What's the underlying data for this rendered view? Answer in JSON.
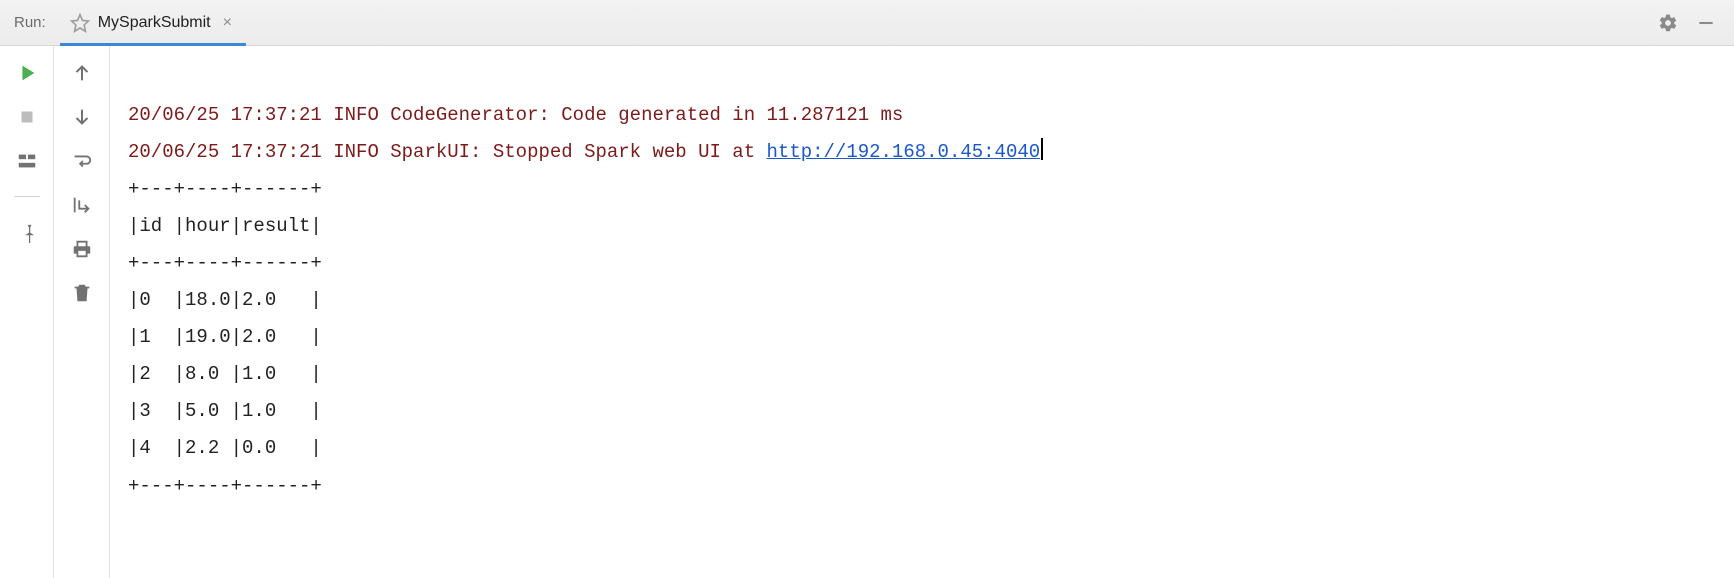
{
  "header": {
    "run_label": "Run:",
    "tab_title": "MySparkSubmit",
    "close_glyph": "×"
  },
  "icons": {
    "gear": "gear-icon",
    "minimize": "minimize-icon",
    "run": "run-icon",
    "stop": "stop-icon",
    "layout": "layout-icon",
    "pin": "pin-icon",
    "arrow_up": "arrow-up-icon",
    "arrow_down": "arrow-down-icon",
    "wrap": "wrap-icon",
    "scroll_end": "scroll-to-end-icon",
    "print": "print-icon",
    "trash": "trash-icon",
    "star": "star-icon"
  },
  "console": {
    "line1_red": "20/06/25 17:37:21 INFO CodeGenerator: Code generated in 11.287121 ms",
    "line2_red_prefix": "20/06/25 17:37:21 INFO SparkUI: Stopped Spark web UI at ",
    "line2_link": "http://192.168.0.45:4040",
    "table_sep": "+---+----+------+",
    "table_head": "|id |hour|result|",
    "table_rows": [
      "|0  |18.0|2.0   |",
      "|1  |19.0|2.0   |",
      "|2  |8.0 |1.0   |",
      "|3  |5.0 |1.0   |",
      "|4  |2.2 |0.0   |"
    ]
  },
  "chart_data": {
    "type": "table",
    "columns": [
      "id",
      "hour",
      "result"
    ],
    "rows": [
      [
        0,
        18.0,
        2.0
      ],
      [
        1,
        19.0,
        2.0
      ],
      [
        2,
        8.0,
        1.0
      ],
      [
        3,
        5.0,
        1.0
      ],
      [
        4,
        2.2,
        0.0
      ]
    ]
  }
}
